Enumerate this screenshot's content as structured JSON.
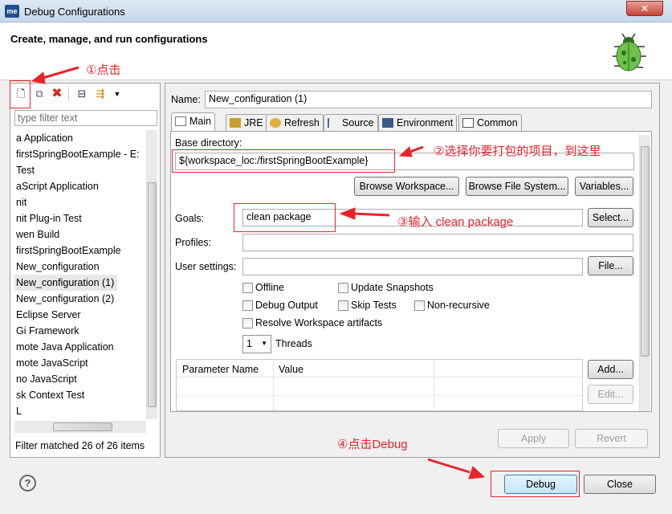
{
  "window": {
    "title": "Debug Configurations",
    "app_icon": "me",
    "close": "✕"
  },
  "header": {
    "title": "Create, manage, and run configurations"
  },
  "left": {
    "filter_placeholder": "type filter text",
    "items": [
      "a Application",
      "firstSpringBootExample - E:",
      "Test",
      "aScript Application",
      "nit",
      "nit Plug-in Test",
      "wen Build",
      "firstSpringBootExample",
      "New_configuration",
      "New_configuration (1)",
      "New_configuration (2)",
      "Eclipse Server",
      "Gi Framework",
      "mote Java Application",
      "mote JavaScript",
      "no JavaScript",
      "sk Context Test",
      "L"
    ],
    "selected_index": 9,
    "status": "Filter matched 26 of 26 items"
  },
  "right": {
    "name_label": "Name:",
    "name_value": "New_configuration (1)",
    "tabs": [
      "Main",
      "JRE",
      "Refresh",
      "Source",
      "Environment",
      "Common"
    ],
    "active_tab": "Main",
    "base_dir_label": "Base directory:",
    "base_dir_value": "${workspace_loc:/firstSpringBootExample}",
    "browse_workspace": "Browse Workspace...",
    "browse_fs": "Browse File System...",
    "variables": "Variables...",
    "goals_label": "Goals:",
    "goals_value": "clean package",
    "select": "Select...",
    "profiles_label": "Profiles:",
    "profiles_value": "",
    "user_settings_label": "User settings:",
    "user_settings_value": "",
    "file": "File...",
    "checkboxes": {
      "offline": "Offline",
      "update_snapshots": "Update Snapshots",
      "debug_output": "Debug Output",
      "skip_tests": "Skip Tests",
      "non_recursive": "Non-recursive",
      "resolve_workspace": "Resolve Workspace artifacts"
    },
    "threads_value": "1",
    "threads_label": "Threads",
    "params_headers": [
      "Parameter Name",
      "Value"
    ],
    "add": "Add...",
    "edit": "Edit...",
    "apply": "Apply",
    "revert": "Revert"
  },
  "footer": {
    "help": "?",
    "debug": "Debug",
    "close": "Close"
  },
  "annotations": {
    "a1": "①点击",
    "a2": "②选择你要打包的项目，到这里",
    "a3": "③输入 clean package",
    "a4": "④点击Debug",
    "color": "#e8242a"
  }
}
